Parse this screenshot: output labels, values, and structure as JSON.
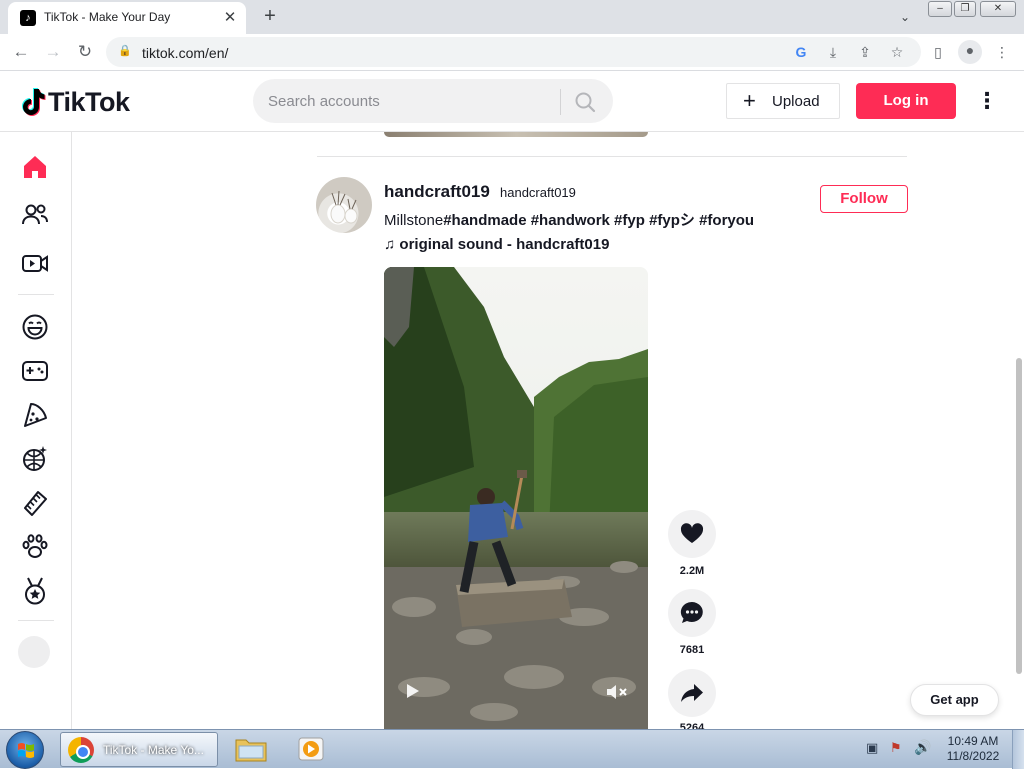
{
  "browser": {
    "tab_title": "TikTok - Make Your Day",
    "url": "tiktok.com/en/"
  },
  "header": {
    "logo_text": "TikTok",
    "search_placeholder": "Search accounts",
    "upload_label": "Upload",
    "login_label": "Log in"
  },
  "sidebar": {
    "items": [
      {
        "name": "home-icon",
        "active": true
      },
      {
        "name": "following-icon"
      },
      {
        "name": "live-icon"
      },
      {
        "name": "comedy-icon"
      },
      {
        "name": "gaming-icon"
      },
      {
        "name": "food-icon"
      },
      {
        "name": "dance-icon"
      },
      {
        "name": "beauty-icon"
      },
      {
        "name": "animals-icon"
      },
      {
        "name": "sports-icon"
      }
    ]
  },
  "post": {
    "username": "handcraft019",
    "nickname": "handcraft019",
    "caption_text": "Millstone",
    "caption_tags": "#handmade #handwork #fyp #fypシ #foryou",
    "sound": "original sound - handcraft019",
    "follow_label": "Follow",
    "likes": "2.2M",
    "comments": "7681",
    "shares": "5264"
  },
  "get_app_label": "Get app",
  "taskbar": {
    "chrome_label": "TikTok - Make Yo...",
    "time": "10:49 AM",
    "date": "11/8/2022"
  },
  "colors": {
    "accent": "#fe2c55",
    "text": "#161823"
  }
}
